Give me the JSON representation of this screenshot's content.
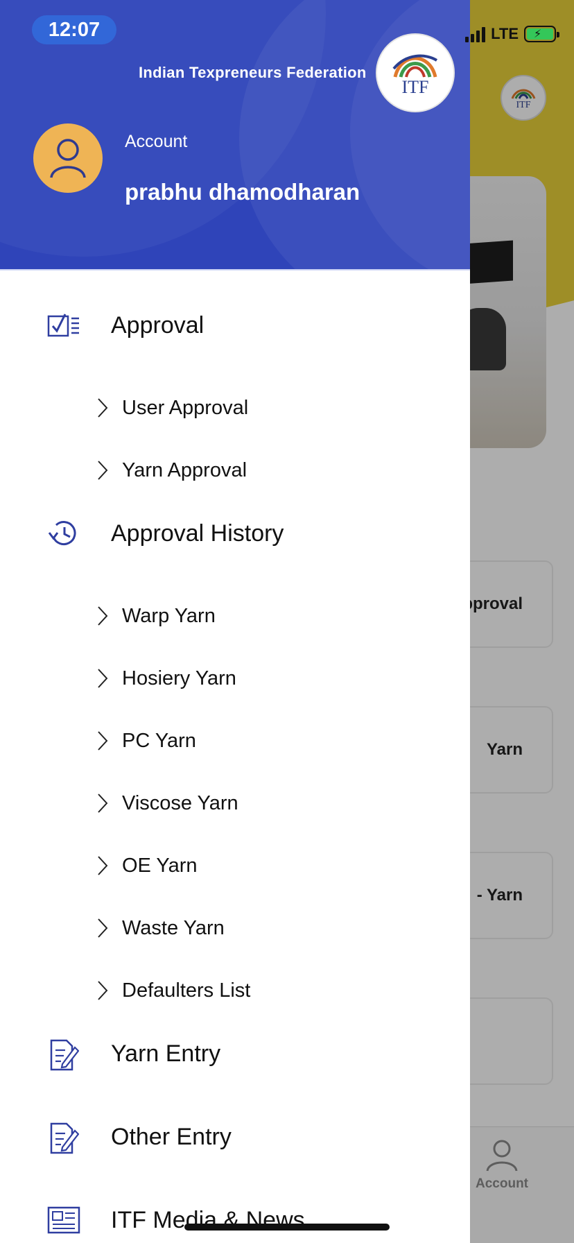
{
  "status_bar": {
    "time": "12:07",
    "network": "LTE"
  },
  "header": {
    "org_name": "Indian Texpreneurs Federation",
    "logo_text": "ITF",
    "account_label": "Account",
    "user_name": "prabhu dhamodharan",
    "colors": {
      "header_bg": "#2f44b9",
      "avatar_bg": "#efb455",
      "icon_color": "#2f3ea0"
    }
  },
  "menu": {
    "approval": {
      "label": "Approval",
      "icon": "checklist-icon",
      "items": [
        {
          "label": "User Approval"
        },
        {
          "label": "Yarn Approval"
        }
      ]
    },
    "approval_history": {
      "label": "Approval History",
      "icon": "history-icon",
      "items": [
        {
          "label": "Warp Yarn"
        },
        {
          "label": "Hosiery Yarn"
        },
        {
          "label": "PC Yarn"
        },
        {
          "label": "Viscose Yarn"
        },
        {
          "label": "OE Yarn"
        },
        {
          "label": "Waste Yarn"
        },
        {
          "label": "Defaulters List"
        }
      ]
    },
    "yarn_entry": {
      "label": "Yarn Entry",
      "icon": "edit-document-icon"
    },
    "other_entry": {
      "label": "Other Entry",
      "icon": "edit-document-icon"
    },
    "media_news": {
      "label": "ITF Media & News",
      "icon": "newspaper-icon"
    }
  },
  "background_screen": {
    "logo_text": "ITF",
    "cards": [
      "pproval",
      "Yarn",
      "- Yarn"
    ],
    "tab_account_label": "Account"
  }
}
